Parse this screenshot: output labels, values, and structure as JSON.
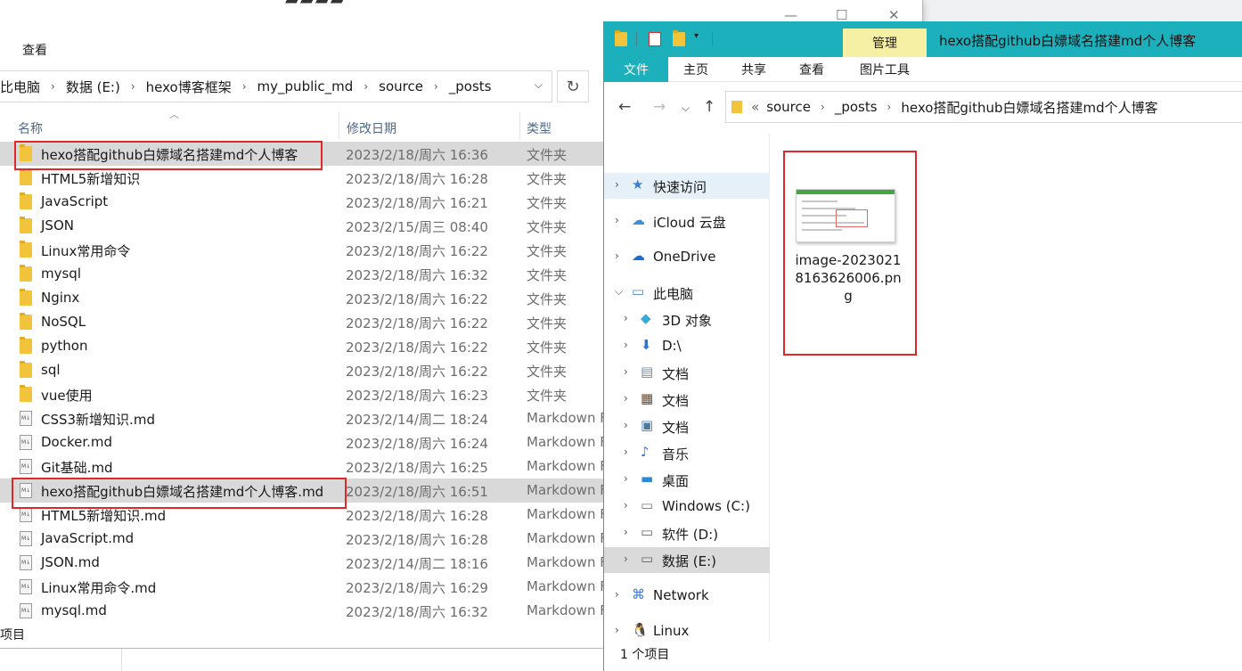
{
  "left": {
    "ribbon_label": "查看",
    "address": [
      "比电脑",
      "数据 (E:)",
      "hexo博客框架",
      "my_public_md",
      "source",
      "_posts"
    ],
    "columns": {
      "name": "名称",
      "date": "修改日期",
      "type": "类型"
    },
    "files": [
      {
        "name": "hexo搭配github白嫖域名搭建md个人博客",
        "date": "2023/2/18/周六 16:36",
        "type": "文件夹",
        "kind": "folder"
      },
      {
        "name": "HTML5新增知识",
        "date": "2023/2/18/周六 16:28",
        "type": "文件夹",
        "kind": "folder"
      },
      {
        "name": "JavaScript",
        "date": "2023/2/18/周六 16:21",
        "type": "文件夹",
        "kind": "folder"
      },
      {
        "name": "JSON",
        "date": "2023/2/15/周三 08:40",
        "type": "文件夹",
        "kind": "folder"
      },
      {
        "name": "Linux常用命令",
        "date": "2023/2/18/周六 16:22",
        "type": "文件夹",
        "kind": "folder"
      },
      {
        "name": "mysql",
        "date": "2023/2/18/周六 16:32",
        "type": "文件夹",
        "kind": "folder"
      },
      {
        "name": "Nginx",
        "date": "2023/2/18/周六 16:22",
        "type": "文件夹",
        "kind": "folder"
      },
      {
        "name": "NoSQL",
        "date": "2023/2/18/周六 16:22",
        "type": "文件夹",
        "kind": "folder"
      },
      {
        "name": "python",
        "date": "2023/2/18/周六 16:22",
        "type": "文件夹",
        "kind": "folder"
      },
      {
        "name": "sql",
        "date": "2023/2/18/周六 16:22",
        "type": "文件夹",
        "kind": "folder"
      },
      {
        "name": "vue使用",
        "date": "2023/2/18/周六 16:23",
        "type": "文件夹",
        "kind": "folder"
      },
      {
        "name": "CSS3新增知识.md",
        "date": "2023/2/14/周二 18:24",
        "type": "Markdown F",
        "kind": "md"
      },
      {
        "name": "Docker.md",
        "date": "2023/2/18/周六 16:24",
        "type": "Markdown F",
        "kind": "md"
      },
      {
        "name": "Git基础.md",
        "date": "2023/2/18/周六 16:25",
        "type": "Markdown F",
        "kind": "md"
      },
      {
        "name": "hexo搭配github白嫖域名搭建md个人博客.md",
        "date": "2023/2/18/周六 16:51",
        "type": "Markdown F",
        "kind": "md"
      },
      {
        "name": "HTML5新增知识.md",
        "date": "2023/2/18/周六 16:28",
        "type": "Markdown F",
        "kind": "md"
      },
      {
        "name": "JavaScript.md",
        "date": "2023/2/18/周六 16:28",
        "type": "Markdown F",
        "kind": "md"
      },
      {
        "name": "JSON.md",
        "date": "2023/2/14/周二 18:16",
        "type": "Markdown F",
        "kind": "md"
      },
      {
        "name": "Linux常用命令.md",
        "date": "2023/2/18/周六 16:29",
        "type": "Markdown F",
        "kind": "md"
      },
      {
        "name": "mysql.md",
        "date": "2023/2/18/周六 16:32",
        "type": "Markdown F",
        "kind": "md"
      }
    ],
    "status": "项目"
  },
  "right": {
    "manage_tab": "管理",
    "window_title": "hexo搭配github白嫖域名搭建md个人博客",
    "tabs": [
      "文件",
      "主页",
      "共享",
      "查看",
      "图片工具"
    ],
    "address_prefix": "«",
    "address": [
      "source",
      "_posts",
      "hexo搭配github白嫖域名搭建md个人博客"
    ],
    "nav_items": [
      {
        "label": "快速访问",
        "icon": "star-icon",
        "level": 0
      },
      {
        "label": "iCloud 云盘",
        "icon": "icloud-icon",
        "level": 0
      },
      {
        "label": "OneDrive",
        "icon": "onedrive-icon",
        "level": 0
      },
      {
        "label": "此电脑",
        "icon": "computer-icon",
        "level": 0
      },
      {
        "label": "3D 对象",
        "icon": "cube-icon",
        "level": 1
      },
      {
        "label": "D:\\",
        "icon": "download-icon",
        "level": 1
      },
      {
        "label": "文档",
        "icon": "document-icon",
        "level": 1
      },
      {
        "label": "文档",
        "icon": "video-icon",
        "level": 1
      },
      {
        "label": "文档",
        "icon": "picture-icon",
        "level": 1
      },
      {
        "label": "音乐",
        "icon": "music-icon",
        "level": 1
      },
      {
        "label": "桌面",
        "icon": "desktop-icon",
        "level": 1
      },
      {
        "label": "Windows (C:)",
        "icon": "windows-drive-icon",
        "level": 1
      },
      {
        "label": "软件 (D:)",
        "icon": "drive-icon",
        "level": 1
      },
      {
        "label": "数据 (E:)",
        "icon": "drive-icon",
        "level": 1
      },
      {
        "label": "Network",
        "icon": "network-icon",
        "level": 0
      },
      {
        "label": "Linux",
        "icon": "linux-icon",
        "level": 0
      }
    ],
    "file_name": "image-20230218163626006.png",
    "status": "1 个项目"
  }
}
